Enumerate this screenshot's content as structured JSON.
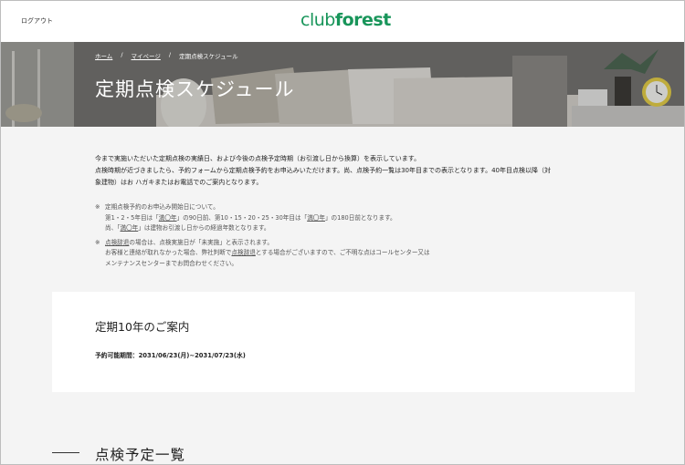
{
  "header": {
    "logout_label": "ログアウト",
    "logo_light": "club",
    "logo_bold": "forest",
    "brand_color": "#18955a"
  },
  "breadcrumb": {
    "home": "ホーム",
    "mypage": "マイページ",
    "current": "定期点検スケジュール",
    "separator": "/"
  },
  "hero": {
    "title": "定期点検スケジュール"
  },
  "intro": {
    "line1": "今まで実施いただいた定期点検の実績日、および今後の点検予定時期（お引渡し日から換算）を表示しています。",
    "line2": "点検時期が近づきましたら、予約フォームから定期点検予約をお申込みいただけます。尚、点検予約一覧は30年目までの表示となります。40年目点検以降（対",
    "line3": "象建物）はお ハガキまたはお電話でのご案内となります。"
  },
  "notes": {
    "mark": "※",
    "n1_line1": "定期点検予約のお申込み開始日について。",
    "n1_line2_a": "第1・2・5年目は「",
    "n1_line2_b": "満〇年",
    "n1_line2_c": "」の90日前、第10・15・20・25・30年目は「",
    "n1_line2_d": "満〇年",
    "n1_line2_e": "」の180日前となります。",
    "n1_line3_a": "尚、「",
    "n1_line3_b": "満〇年",
    "n1_line3_c": "」は建物お引渡し日からの経過年数となります。",
    "n2_line1_a": "",
    "n2_line1_b": "点検辞退",
    "n2_line1_c": "の場合は、点検実施日が「未実施」と表示されます。",
    "n2_line2_a": "お客様と連絡が取れなかった場合、弊社判断で",
    "n2_line2_b": "点検辞退",
    "n2_line2_c": "とする場合がございますので、ご不明な点はコールセンター又は",
    "n2_line3": "メンテナンスセンターまでお問合わせください。"
  },
  "card": {
    "title": "定期10年のご案内",
    "period": "予約可能期間：2031/06/23(月)~2031/07/23(水)"
  },
  "section": {
    "title": "点検予定一覧"
  }
}
